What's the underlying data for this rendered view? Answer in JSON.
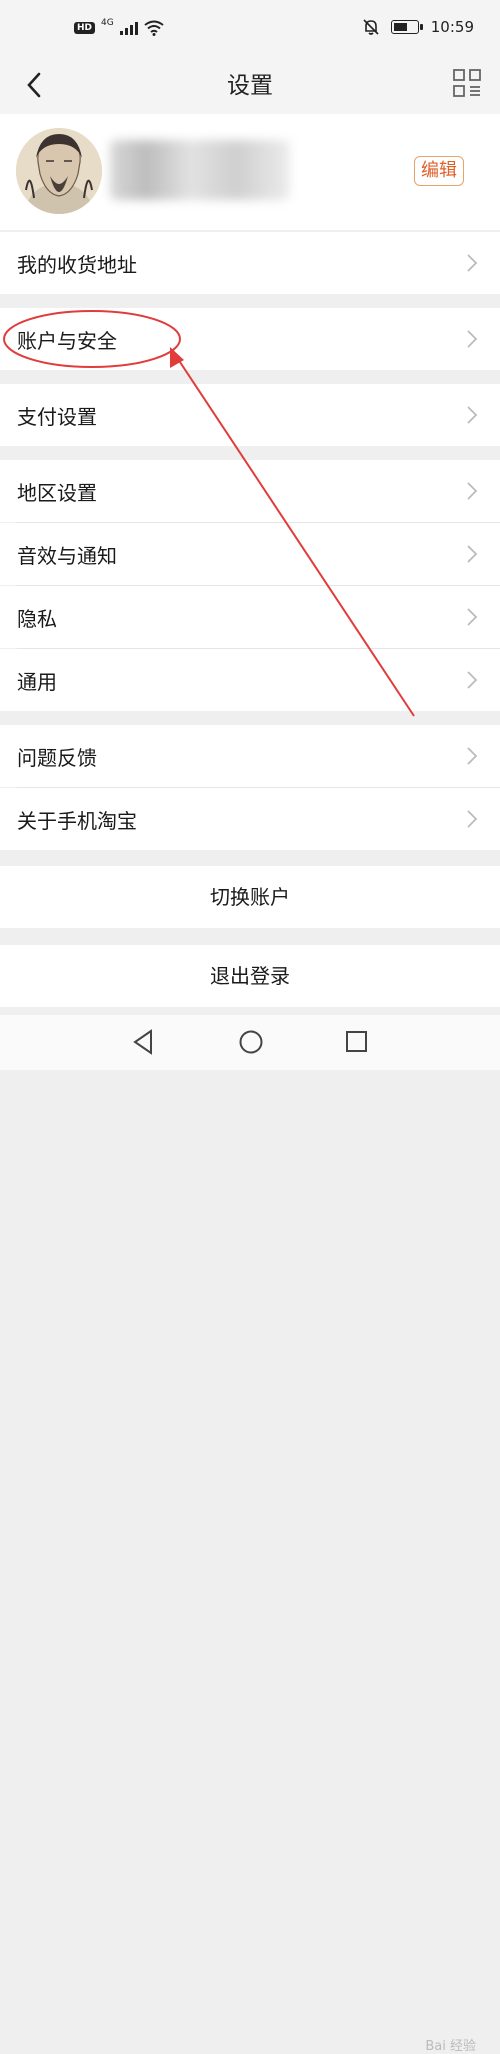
{
  "status_bar": {
    "hd_badge": "HD",
    "network_label": "4G",
    "time": "10:59",
    "battery_level": 0.6,
    "icons": [
      "hd-icon",
      "signal-icon",
      "wifi-icon",
      "mute-bell-icon",
      "battery-icon"
    ]
  },
  "nav": {
    "title": "设置",
    "back_icon": "chevron-left-icon",
    "menu_icon": "grid-icon"
  },
  "profile": {
    "edit_label": "编辑",
    "accent_color": "#e0602a"
  },
  "menu_groups": [
    {
      "items": [
        {
          "label": "我的收货地址"
        }
      ]
    },
    {
      "items": [
        {
          "label": "账户与安全"
        }
      ]
    },
    {
      "items": [
        {
          "label": "支付设置"
        }
      ]
    },
    {
      "items": [
        {
          "label": "地区设置"
        },
        {
          "label": "音效与通知"
        },
        {
          "label": "隐私"
        },
        {
          "label": "通用"
        }
      ]
    },
    {
      "items": [
        {
          "label": "问题反馈"
        },
        {
          "label": "关于手机淘宝"
        }
      ]
    }
  ],
  "actions": {
    "switch_account": "切换账户",
    "logout": "退出登录"
  },
  "annotation": {
    "color": "#e03c3c",
    "highlighted_item": "账户与安全"
  },
  "watermark": "Bai 经验",
  "system_nav": [
    "back-triangle-icon",
    "home-circle-icon",
    "recents-square-icon"
  ]
}
